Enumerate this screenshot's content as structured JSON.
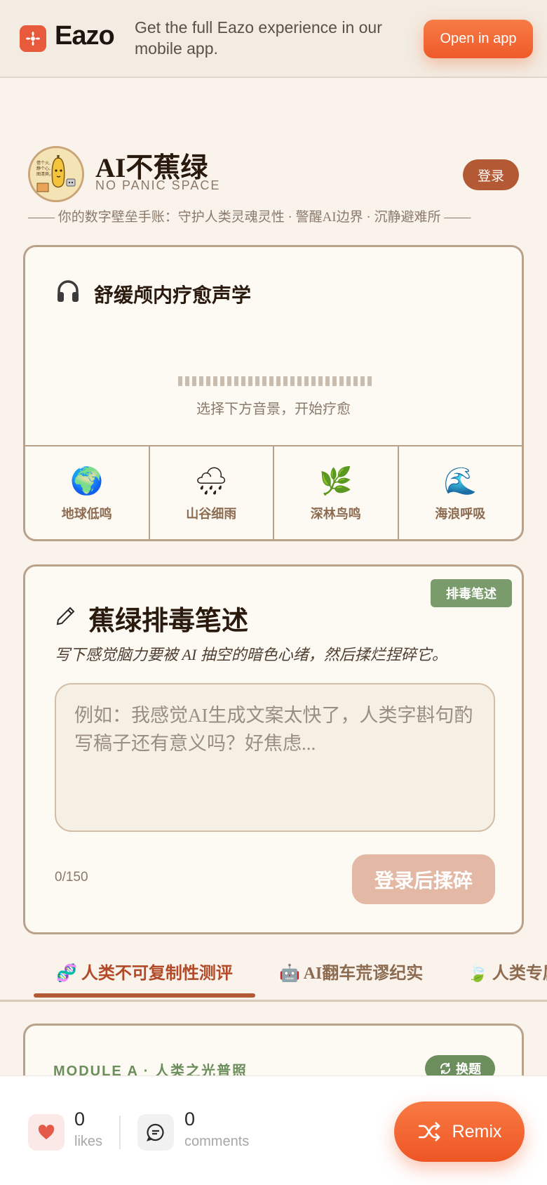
{
  "banner": {
    "logo_text": "Eazo",
    "message": "Get the full Eazo experience in our mobile app.",
    "open_app_label": "Open in app",
    "brand_color": "#e85a3c"
  },
  "header": {
    "title": "AI不蕉绿",
    "subtitle": "NO PANIC SPACE",
    "login_label": "登录",
    "tagline": "—— 你的数字壁垒手账：守护人类灵魂灵性 · 警醒AI边界 · 沉静避难所 ——",
    "avatar_lines": [
      "借个火,",
      "静个心,",
      "图清爽。"
    ]
  },
  "sound": {
    "icon": "headphones-icon",
    "title": "舒缓颅内疗愈声学",
    "hint": "选择下方音景，开始疗愈",
    "scenes": [
      {
        "emoji": "🌍",
        "label": "地球低鸣"
      },
      {
        "emoji": "🌧",
        "label": "山谷细雨"
      },
      {
        "emoji": "🌿",
        "label": "深林鸟鸣"
      },
      {
        "emoji": "🌊",
        "label": "海浪呼吸"
      }
    ]
  },
  "detox": {
    "badge": "排毒笔述",
    "icon": "pen-icon",
    "title": "蕉绿排毒笔述",
    "description": "写下感觉脑力要被 AI 抽空的暗色心绪，然后揉烂捏碎它。",
    "placeholder": "例如：我感觉AI生成文案太快了，人类字斟句酌写稿子还有意义吗？好焦虑...",
    "counter": "0/150",
    "submit_label": "登录后揉碎"
  },
  "tabs": [
    {
      "emoji": "🧬",
      "label": "人类不可复制性测评",
      "active": true
    },
    {
      "emoji": "🤖",
      "label": "AI翻车荒谬纪实",
      "active": false
    },
    {
      "emoji": "🍃",
      "label": "人类专属",
      "active": false
    }
  ],
  "module": {
    "label": "MODULE A · 人类之光普照",
    "swap_label": "换题"
  },
  "bottom": {
    "likes_count": "0",
    "likes_label": "likes",
    "comments_count": "0",
    "comments_label": "comments",
    "remix_label": "Remix"
  }
}
